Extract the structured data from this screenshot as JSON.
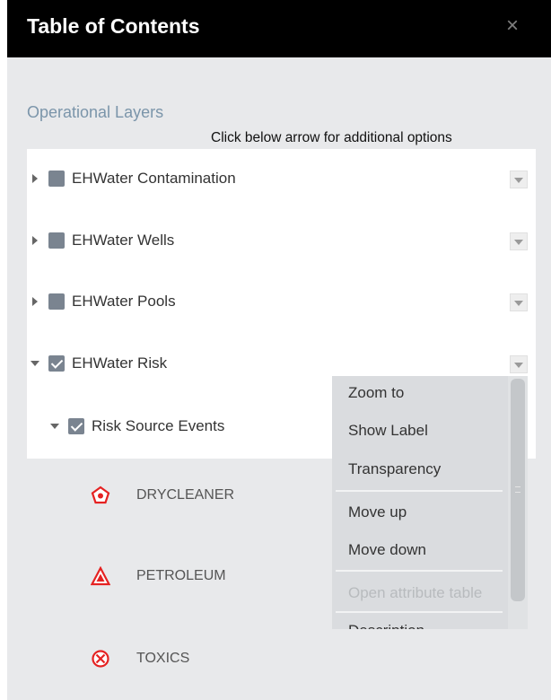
{
  "header": {
    "title": "Table of Contents",
    "close_glyph": "×"
  },
  "section": {
    "label": "Operational Layers",
    "hint": "Click below arrow for additional options"
  },
  "layers": [
    {
      "label": "EHWater Contamination",
      "checked": false,
      "expanded": false
    },
    {
      "label": "EHWater Wells",
      "checked": false,
      "expanded": false
    },
    {
      "label": "EHWater Pools",
      "checked": false,
      "expanded": false
    },
    {
      "label": "EHWater Risk",
      "checked": true,
      "expanded": true
    }
  ],
  "sublayer": {
    "label": "Risk Source Events",
    "checked": true,
    "expanded": true
  },
  "legend": [
    {
      "label": "DRYCLEANER",
      "icon": "pentagon-marker-icon",
      "color": "#e52222"
    },
    {
      "label": "PETROLEUM",
      "icon": "triangle-marker-icon",
      "color": "#e52222"
    },
    {
      "label": "TOXICS",
      "icon": "circle-x-marker-icon",
      "color": "#e52222"
    }
  ],
  "menu": {
    "items": [
      {
        "label": "Zoom to",
        "enabled": true
      },
      {
        "label": "Show Label",
        "enabled": true
      },
      {
        "label": "Transparency",
        "enabled": true
      },
      {
        "label": "Move up",
        "enabled": true
      },
      {
        "label": "Move down",
        "enabled": true
      },
      {
        "label": "Open attribute table",
        "enabled": false
      },
      {
        "label": "Description",
        "enabled": true
      }
    ]
  },
  "colors": {
    "header_bg": "#000000",
    "panel_bg": "#e8e9eb",
    "section_label": "#7b95aa",
    "checkbox": "#7a8490",
    "marker_red": "#e52222",
    "menu_bg": "#dadcdf"
  }
}
